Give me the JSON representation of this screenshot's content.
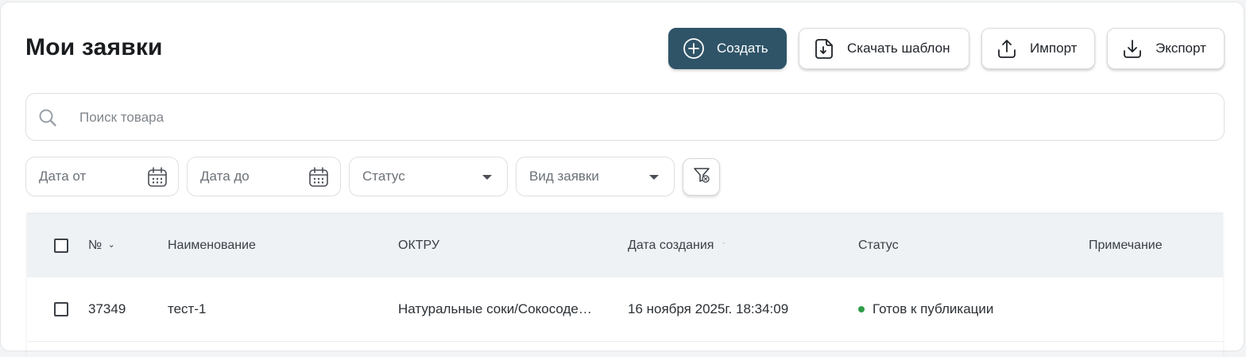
{
  "header": {
    "title": "Мои заявки"
  },
  "toolbar": {
    "create_label": "Создать",
    "download_template_label": "Скачать шаблон",
    "import_label": "Импорт",
    "export_label": "Экспорт"
  },
  "search": {
    "placeholder": "Поиск товара"
  },
  "filters": {
    "date_from": "Дата от",
    "date_to": "Дата до",
    "status": "Статус",
    "request_type": "Вид заявки"
  },
  "table": {
    "columns": [
      "№",
      "Наименование",
      "ОКТРУ",
      "Дата создания",
      "Статус",
      "Примечание"
    ],
    "rows": [
      {
        "number": "37349",
        "name": "тест-1",
        "oktru": "Натуральные соки/Сокосодержащие напитки",
        "created": "16 ноября 2025г. 18:34:09",
        "status": "Готов к публикации",
        "note": ""
      }
    ]
  },
  "colors": {
    "primary": "#2f5468",
    "status_ready": "#2e9d48",
    "header_bg": "#eef2f5"
  }
}
